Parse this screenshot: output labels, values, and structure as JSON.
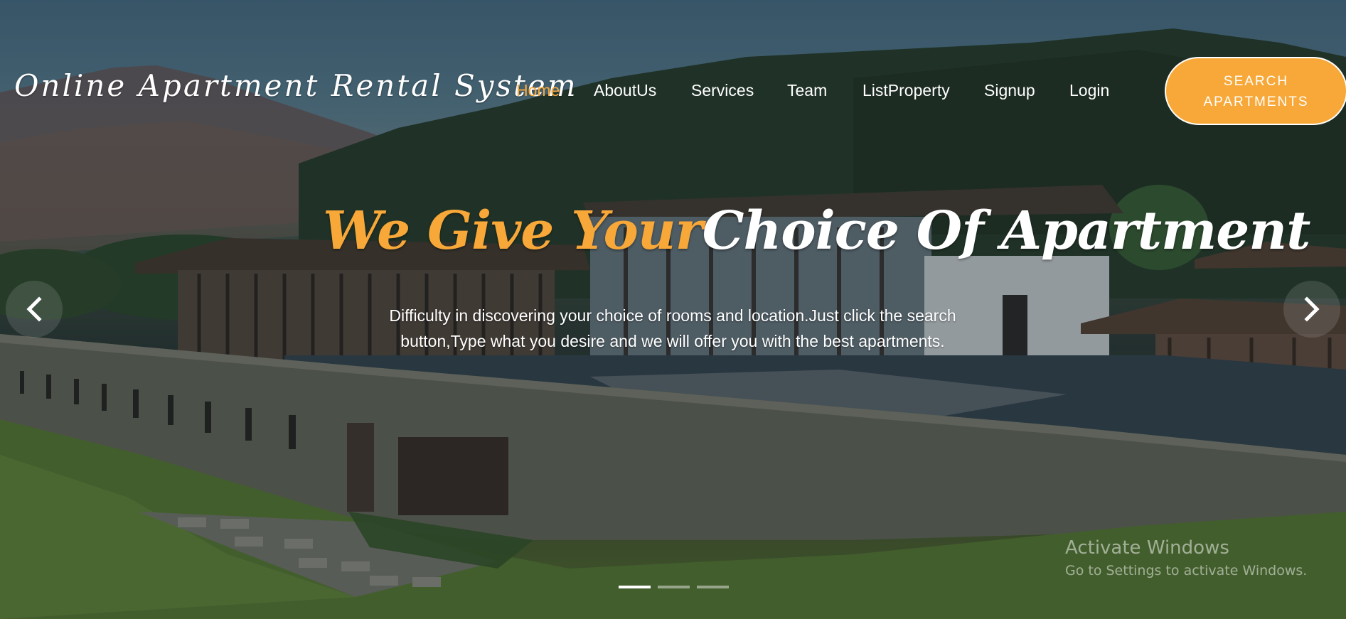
{
  "header": {
    "brand": "Online Apartment Rental System",
    "nav": [
      {
        "label": "Home",
        "active": true
      },
      {
        "label": "AboutUs",
        "active": false
      },
      {
        "label": "Services",
        "active": false
      },
      {
        "label": "Team",
        "active": false
      },
      {
        "label": "ListProperty",
        "active": false
      },
      {
        "label": "Signup",
        "active": false
      },
      {
        "label": "Login",
        "active": false
      }
    ],
    "search_button": {
      "line1": "SEARCH",
      "line2": "APARTMENTS"
    }
  },
  "hero": {
    "headline_accent": "We Give Your",
    "headline_rest": "Choice Of Apartment",
    "subtitle": "Difficulty in discovering your choice of rooms and location.Just click the search button,Type what you desire and we will offer you with the best apartments.",
    "prev_icon": "chevron-left-icon",
    "next_icon": "chevron-right-icon",
    "slides": 3,
    "active_slide": 1
  },
  "watermark": {
    "title": "Activate Windows",
    "subtitle": "Go to Settings to activate Windows."
  },
  "colors": {
    "accent": "#f7a838",
    "text": "#ffffff"
  }
}
